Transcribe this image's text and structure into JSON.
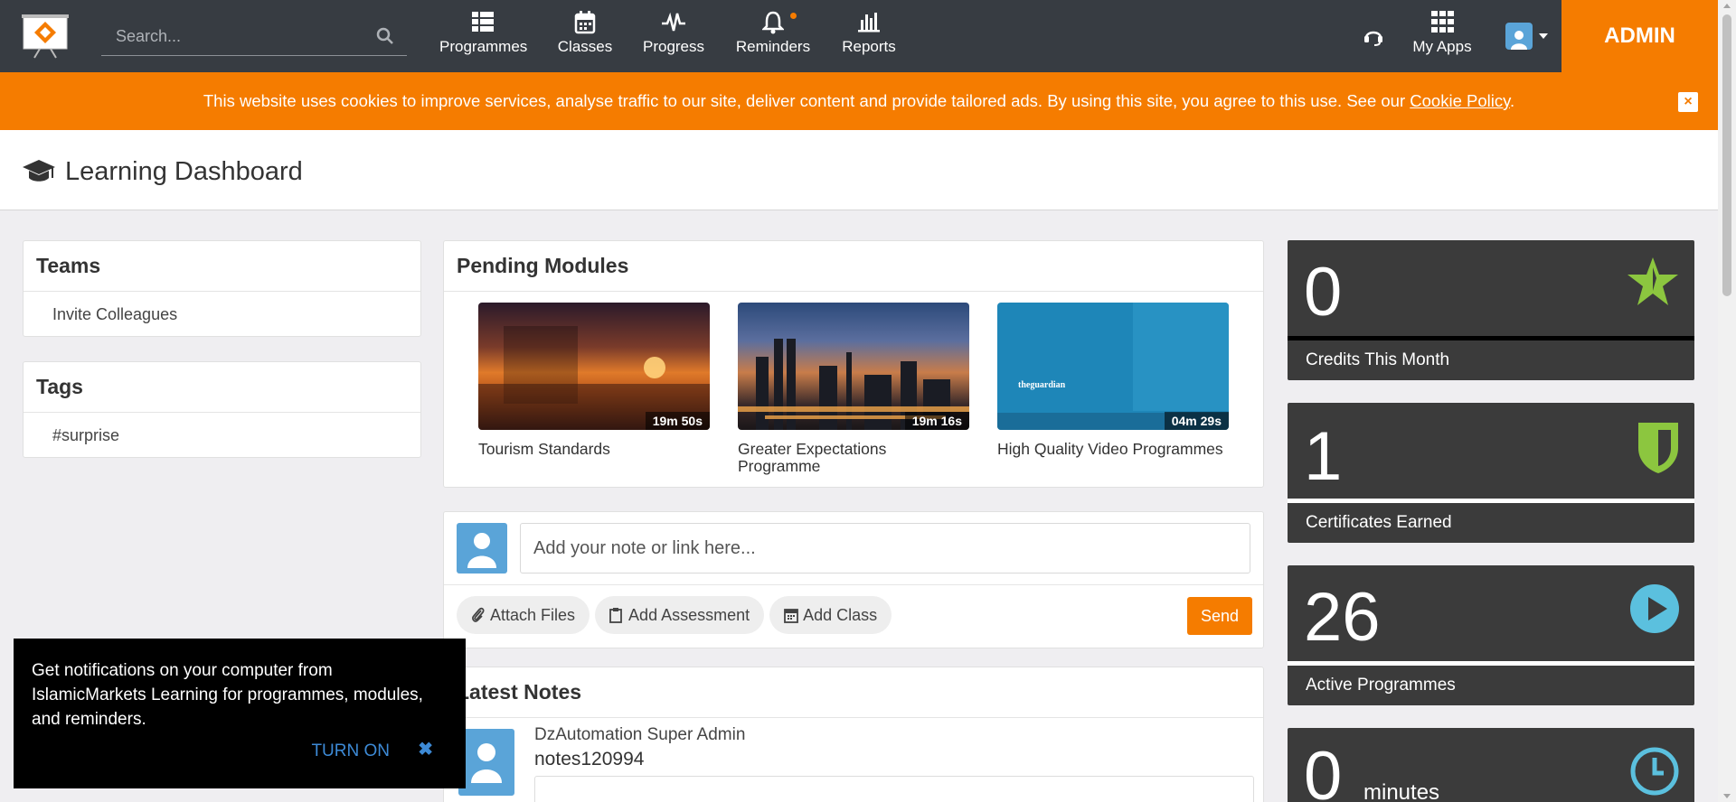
{
  "nav": {
    "search_placeholder": "Search...",
    "items": [
      {
        "label": "Programmes",
        "icon": "grid-list-icon"
      },
      {
        "label": "Classes",
        "icon": "calendar-icon"
      },
      {
        "label": "Progress",
        "icon": "pulse-icon"
      },
      {
        "label": "Reminders",
        "icon": "bell-icon"
      },
      {
        "label": "Reports",
        "icon": "bar-chart-icon"
      }
    ],
    "my_apps": "My Apps",
    "admin": "ADMIN"
  },
  "cookie": {
    "text": "This website uses cookies to improve services, analyse traffic to our site, deliver content and provide tailored ads. By using this site, you agree to this use. See our ",
    "link": "Cookie Policy",
    "tail": ".",
    "close": "×"
  },
  "page": {
    "title": "Learning Dashboard"
  },
  "teams": {
    "title": "Teams",
    "items": [
      "Invite Colleagues"
    ]
  },
  "tags": {
    "title": "Tags",
    "items": [
      "#surprise"
    ]
  },
  "pending": {
    "title": "Pending Modules",
    "modules": [
      {
        "title": "Tourism Standards",
        "duration": "19m 50s"
      },
      {
        "title": "Greater Expectations Programme",
        "duration": "19m 16s"
      },
      {
        "title": "High Quality Video Programmes",
        "duration": "04m 29s",
        "overlay": "theguardian"
      }
    ]
  },
  "note": {
    "placeholder": "Add your note or link here...",
    "attach": "Attach Files",
    "assessment": "Add Assessment",
    "add_class": "Add Class",
    "send": "Send"
  },
  "latest": {
    "title": "Latest Notes",
    "author": "DzAutomation Super Admin",
    "text": "notes120994"
  },
  "stats": [
    {
      "value": "0",
      "label": "Credits This Month",
      "icon": "star-icon"
    },
    {
      "value": "1",
      "label": "Certificates Earned",
      "icon": "shield-icon"
    },
    {
      "value": "26",
      "label": "Active Programmes",
      "icon": "play-icon"
    },
    {
      "value": "0",
      "label": "minutes",
      "icon": "clock-icon"
    }
  ],
  "toast": {
    "text": "Get notifications on your computer from IslamicMarkets Learning for programmes, modules, and reminders.",
    "turn_on": "TURN ON",
    "close": "✖"
  },
  "colors": {
    "accent": "#f57c00",
    "nav": "#373c42",
    "stat_bg": "#3b3b3b",
    "green": "#8cc63f",
    "blue": "#5bc0de"
  }
}
